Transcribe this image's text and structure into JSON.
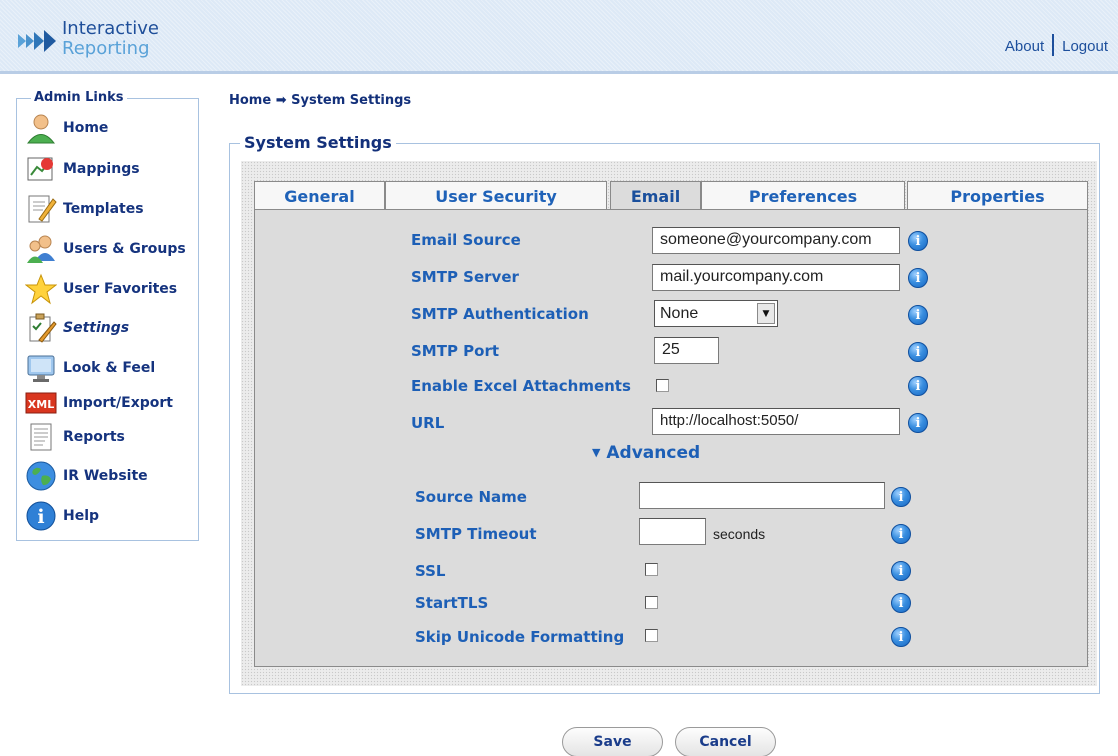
{
  "header": {
    "logo_line1": "Interactive",
    "logo_line2": "Reporting",
    "about": "About",
    "logout": "Logout"
  },
  "sidebar": {
    "title": "Admin Links",
    "items": [
      {
        "label": "Home",
        "icon": "user-icon"
      },
      {
        "label": "Mappings",
        "icon": "mappings-icon"
      },
      {
        "label": "Templates",
        "icon": "templates-icon"
      },
      {
        "label": "Users & Groups",
        "icon": "users-groups-icon"
      },
      {
        "label": "User Favorites",
        "icon": "star-icon"
      },
      {
        "label": "Settings",
        "icon": "settings-icon"
      },
      {
        "label": "Look & Feel",
        "icon": "monitor-icon"
      },
      {
        "label": "Import/Export",
        "icon": "xml-icon"
      },
      {
        "label": "Reports",
        "icon": "report-icon"
      },
      {
        "label": "IR Website",
        "icon": "globe-icon"
      },
      {
        "label": "Help",
        "icon": "help-icon"
      }
    ]
  },
  "breadcrumb": "Home ➡ System Settings",
  "panel_title": "System Settings",
  "tabs": [
    "General",
    "User Security",
    "Email",
    "Preferences",
    "Properties"
  ],
  "active_tab": "Email",
  "email": {
    "email_source_label": "Email Source",
    "email_source_value": "someone@yourcompany.com",
    "smtp_server_label": "SMTP Server",
    "smtp_server_value": "mail.yourcompany.com",
    "smtp_auth_label": "SMTP Authentication",
    "smtp_auth_value": "None",
    "smtp_port_label": "SMTP Port",
    "smtp_port_value": "25",
    "excel_label": "Enable Excel Attachments",
    "url_label": "URL",
    "url_value": "http://localhost:5050/",
    "advanced_label": "Advanced",
    "source_name_label": "Source Name",
    "source_name_value": "",
    "smtp_timeout_label": "SMTP Timeout",
    "smtp_timeout_value": "",
    "seconds_label": "seconds",
    "ssl_label": "SSL",
    "starttls_label": "StartTLS",
    "skip_unicode_label": "Skip Unicode Formatting"
  },
  "buttons": {
    "save": "Save",
    "cancel": "Cancel"
  }
}
